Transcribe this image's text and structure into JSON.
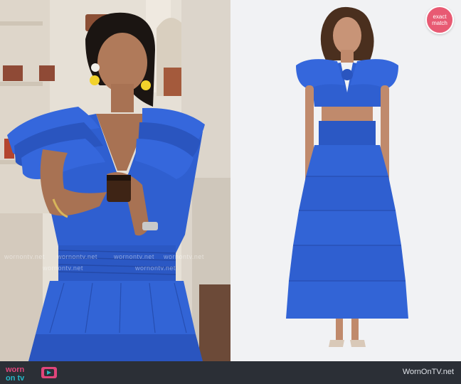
{
  "left_photo": {
    "watermarks": [
      "wornontv.net",
      "wornontv.net",
      "wornontv.net",
      "wornontv.net",
      "wornontv.net",
      "wornontv.net"
    ]
  },
  "right_photo": {
    "badge_line1": "exact",
    "badge_line2": "match",
    "badge_color": "#e85a73"
  },
  "footer": {
    "logo_top": "worn",
    "logo_bottom": "on tv",
    "site_credit": "WornOnTV.net",
    "bar_color": "#2b2f36"
  },
  "colors": {
    "dress_blue": "#2f5fd0",
    "logo_pink": "#e0457b",
    "logo_teal": "#27b7c7"
  }
}
